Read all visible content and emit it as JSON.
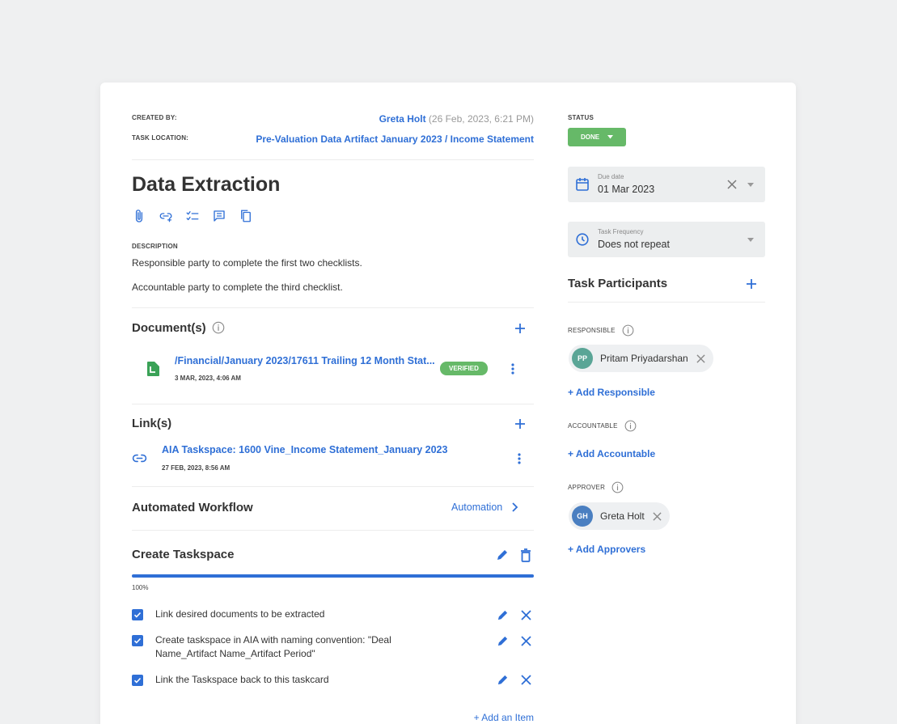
{
  "meta": {
    "created_by_label": "CREATED BY:",
    "created_by_name": "Greta Holt",
    "created_by_date": "(26 Feb, 2023, 6:21 PM)",
    "task_location_label": "TASK LOCATION:",
    "task_location": "Pre-Valuation Data Artifact January 2023 / Income Statement"
  },
  "task": {
    "title": "Data Extraction",
    "toolbar_icons": [
      "paperclip-icon",
      "add-link-icon",
      "checklist-icon",
      "comment-icon",
      "copy-icon"
    ],
    "description_label": "DESCRIPTION",
    "description_lines": [
      "Responsible party to complete the first two checklists.",
      "Accountable party to complete the third checklist."
    ]
  },
  "documents": {
    "title": "Document(s)",
    "items": [
      {
        "path": "/Financial/January 2023/17611 Trailing 12 Month Stat...",
        "date": "3 MAR, 2023, 4:06 AM",
        "badge": "VERIFIED"
      }
    ]
  },
  "links": {
    "title": "Link(s)",
    "items": [
      {
        "title": "AIA Taskspace: 1600 Vine_Income Statement_January 2023",
        "date": "27 FEB, 2023, 8:56 AM"
      }
    ]
  },
  "workflow": {
    "title": "Automated Workflow",
    "action": "Automation"
  },
  "checklist": {
    "title": "Create Taskspace",
    "progress_percent": 100,
    "progress_label": "100%",
    "items": [
      {
        "text": "Link desired documents to be extracted",
        "checked": true
      },
      {
        "text": "Create taskspace in AIA with naming convention: \"Deal Name_Artifact Name_Artifact Period\"",
        "checked": true
      },
      {
        "text": "Link the Taskspace back to this taskcard",
        "checked": true
      }
    ],
    "add_item": "+ Add an Item"
  },
  "status": {
    "label": "STATUS",
    "value": "DONE",
    "color": "#66b968"
  },
  "due_date": {
    "label": "Due date",
    "value": "01 Mar 2023"
  },
  "frequency": {
    "label": "Task Frequency",
    "value": "Does not repeat"
  },
  "participants": {
    "title": "Task Participants",
    "responsible_label": "RESPONSIBLE",
    "responsible": [
      {
        "initials": "PP",
        "name": "Pritam Priyadarshan",
        "color": "#5aa596"
      }
    ],
    "add_responsible": "+ Add Responsible",
    "accountable_label": "ACCOUNTABLE",
    "add_accountable": "+ Add Accountable",
    "approver_label": "APPROVER",
    "approvers": [
      {
        "initials": "GH",
        "name": "Greta Holt",
        "color": "#4a7fc1"
      }
    ],
    "add_approvers": "+ Add Approvers"
  },
  "colors": {
    "accent": "#2f6fd6",
    "success": "#66b968",
    "doc_icon": "#3aa257"
  }
}
